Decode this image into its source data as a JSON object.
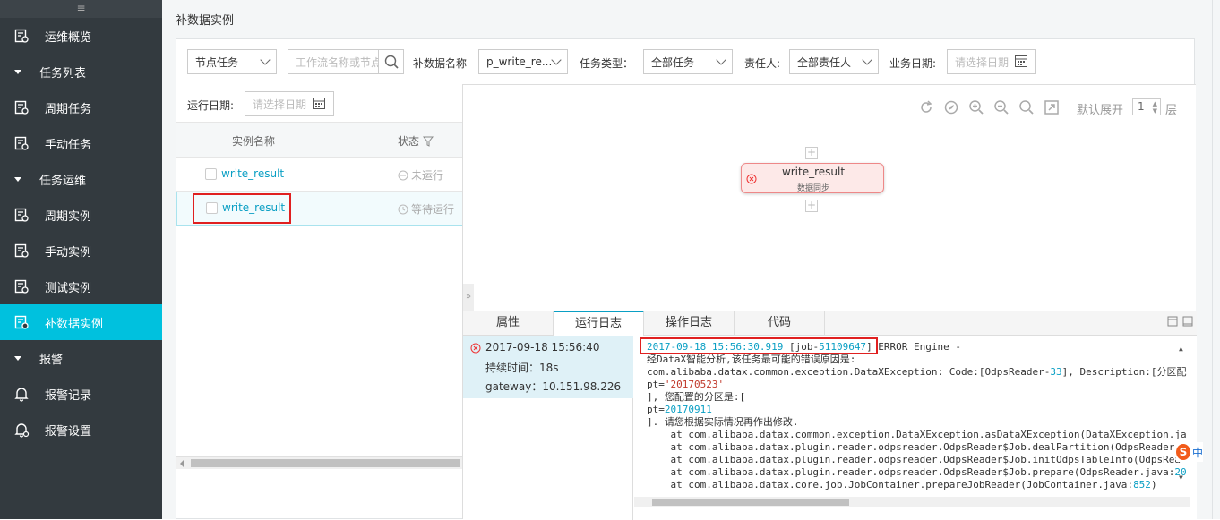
{
  "sidebar": {
    "top_icon": "≡",
    "items": [
      {
        "label": "运维概览",
        "icon": "overview-icon",
        "kind": "child"
      },
      {
        "label": "任务列表",
        "kind": "group"
      },
      {
        "label": "周期任务",
        "icon": "cycle-task-icon",
        "kind": "child"
      },
      {
        "label": "手动任务",
        "icon": "manual-task-icon",
        "kind": "child"
      },
      {
        "label": "任务运维",
        "kind": "group"
      },
      {
        "label": "周期实例",
        "icon": "cycle-instance-icon",
        "kind": "child"
      },
      {
        "label": "手动实例",
        "icon": "manual-instance-icon",
        "kind": "child"
      },
      {
        "label": "测试实例",
        "icon": "test-instance-icon",
        "kind": "child"
      },
      {
        "label": "补数据实例",
        "icon": "backfill-instance-icon",
        "kind": "child",
        "active": true
      },
      {
        "label": "报警",
        "kind": "group"
      },
      {
        "label": "报警记录",
        "icon": "bell-icon",
        "kind": "child"
      },
      {
        "label": "报警设置",
        "icon": "bell-settings-icon",
        "kind": "child"
      }
    ]
  },
  "page": {
    "title": "补数据实例"
  },
  "filters": {
    "node_type": "节点任务",
    "workflow_placeholder": "工作流名称或节点",
    "backfill_name_label": "补数据名称",
    "backfill_name_value": "p_write_re...",
    "task_type_label": "任务类型：",
    "task_type_value": "全部任务",
    "owner_label": "责任人:",
    "owner_value": "全部责任人",
    "biz_date_label": "业务日期:",
    "biz_date_placeholder": "请选择日期",
    "run_date_label": "运行日期:",
    "run_date_placeholder": "请选择日期"
  },
  "table": {
    "headers": {
      "name": "实例名称",
      "status": "状态"
    },
    "rows": [
      {
        "name": "write_result",
        "status": "未运行"
      },
      {
        "name": "write_result",
        "status": "等待运行"
      }
    ]
  },
  "graph": {
    "expand_label": "默认展开",
    "expand_value": "1",
    "layer_label": "层",
    "node": {
      "name": "write_result",
      "type": "数据同步"
    }
  },
  "tabs": [
    "属性",
    "运行日志",
    "操作日志",
    "代码"
  ],
  "active_tab": "运行日志",
  "run": {
    "time": "2017-09-18 15:56:40",
    "duration": "持续时间：18s",
    "gateway": "gateway：10.151.98.226"
  },
  "log": {
    "l1_ts": "2017-09-18 15:56:30.919",
    "l1_job": "[job-51109647]",
    "l1_rest": " ERROR Engine -",
    "l2": "经DataX智能分析,该任务最可能的错误原因是:",
    "l3": "com.alibaba.datax.common.exception.DataXException: Code:[OdpsReader-33], Description:[分区配",
    "l4": "pt='20170523'",
    "l5": "], 您配置的分区是:[",
    "l6": "pt=20170911",
    "l7": "]. 请您根据实际情况再作出修改.",
    "l8": "    at com.alibaba.datax.common.exception.DataXException.asDataXException(DataXException.ja",
    "l9": "    at com.alibaba.datax.plugin.reader.odpsreader.OdpsReader$Job.dealPartition(OdpsReader.",
    "l10": "    at com.alibaba.datax.plugin.reader.odpsreader.OdpsReader$Job.initOdpsTableInfo(OdpsRea",
    "l11": "    at com.alibaba.datax.plugin.reader.odpsreader.OdpsReader$Job.prepare(OdpsReader.java:20",
    "l12": "    at com.alibaba.datax.core.job.JobContainer.prepareJobReader(JobContainer.java:852)"
  },
  "ime_badge": "中",
  "colors": {
    "sidebar_bg": "#333a3f",
    "active": "#00c1de",
    "link": "#0a9fc4",
    "error": "#e02020"
  }
}
